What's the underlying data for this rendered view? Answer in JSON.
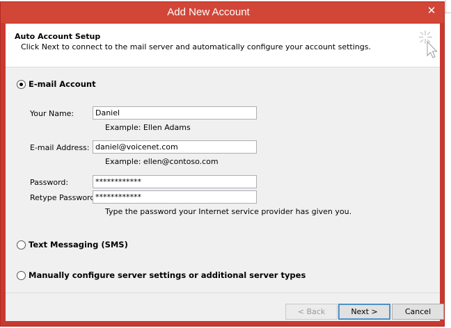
{
  "window": {
    "title": "Add New Account",
    "close_glyph": "✕"
  },
  "header": {
    "title": "Auto Account Setup",
    "subtitle": "Click Next to connect to the mail server and automatically configure your account settings.",
    "icon": "magic-wand-cursor-icon"
  },
  "options": {
    "email": {
      "label": "E-mail Account",
      "selected": true
    },
    "sms": {
      "label": "Text Messaging (SMS)",
      "selected": false
    },
    "manual": {
      "label": "Manually configure server settings or additional server types",
      "selected": false
    }
  },
  "form": {
    "name": {
      "label": "Your Name:",
      "value": "Daniel",
      "example": "Example: Ellen Adams"
    },
    "email": {
      "label": "E-mail Address:",
      "value": "daniel@voicenet.com",
      "example": "Example: ellen@contoso.com"
    },
    "password": {
      "label": "Password:",
      "value": "************"
    },
    "retype": {
      "label": "Retype Password:",
      "value": "************"
    },
    "password_hint": "Type the password your Internet service provider has given you."
  },
  "buttons": {
    "back": "< Back",
    "next": "Next >",
    "cancel": "Cancel"
  },
  "colors": {
    "titlebar": "#d24638",
    "frame": "#c8392f",
    "panel": "#f0f0f0"
  }
}
